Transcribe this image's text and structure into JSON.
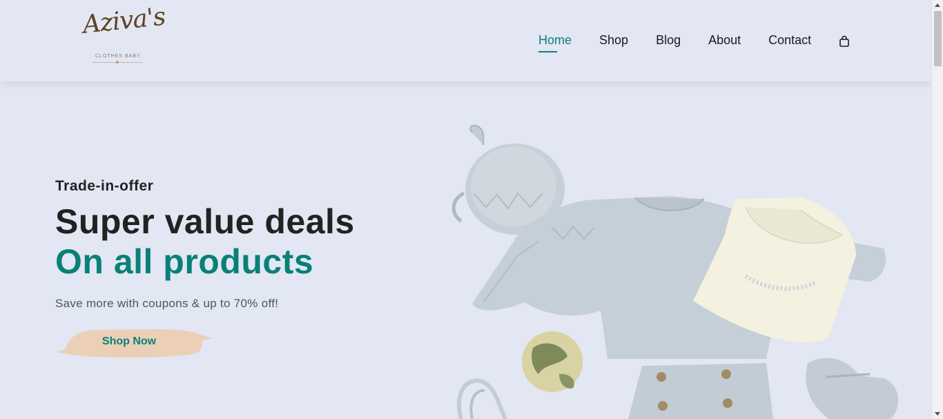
{
  "header": {
    "logo": {
      "script": "Aziva's",
      "subtitle": "CLOTHES BABY"
    },
    "nav": [
      {
        "label": "Home",
        "active": true
      },
      {
        "label": "Shop",
        "active": false
      },
      {
        "label": "Blog",
        "active": false
      },
      {
        "label": "About",
        "active": false
      },
      {
        "label": "Contact",
        "active": false
      }
    ],
    "cart_icon": "shopping-bag-icon"
  },
  "hero": {
    "eyebrow": "Trade-in-offer",
    "title_line1": "Super value deals",
    "title_line2": "On all products",
    "description": "Save more with coupons & up to 70% off!",
    "cta_label": "Shop Now",
    "image": "baby-clothes-flatlay"
  },
  "colors": {
    "background": "#e3e6f3",
    "accent": "#088178",
    "brush": "#ebcfb7",
    "logo": "#5a4520"
  }
}
